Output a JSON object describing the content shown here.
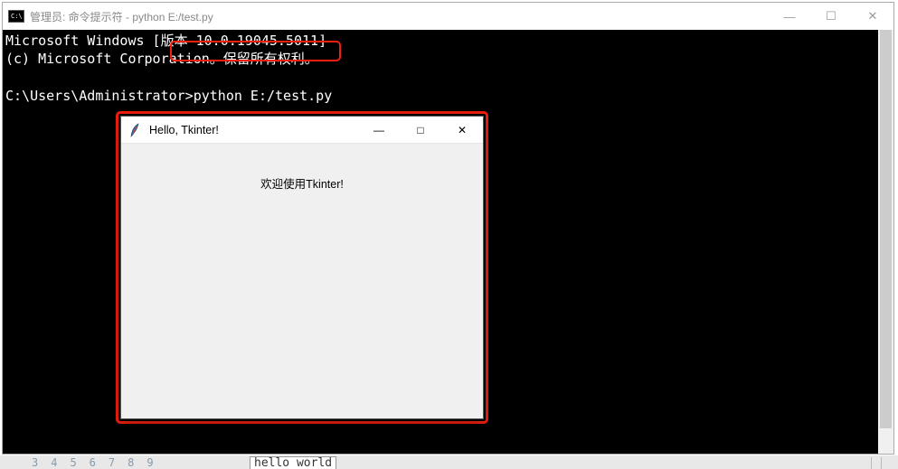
{
  "cmd": {
    "title": "管理员: 命令提示符 - python  E:/test.py",
    "line1": "Microsoft Windows [版本 10.0.19045.5011]",
    "line2": "(c) Microsoft Corporation。保留所有权利。",
    "prompt": "C:\\Users\\Administrator>",
    "command": "python E:/test.py",
    "icon_text": "C:\\"
  },
  "tk": {
    "title": "Hello, Tkinter!",
    "label": "欢迎使用Tkinter!"
  },
  "bottom": {
    "nums": "3456789",
    "hello": "hello world"
  },
  "controls": {
    "min": "—",
    "max_square": "□",
    "max": "☐",
    "close": "✕"
  }
}
